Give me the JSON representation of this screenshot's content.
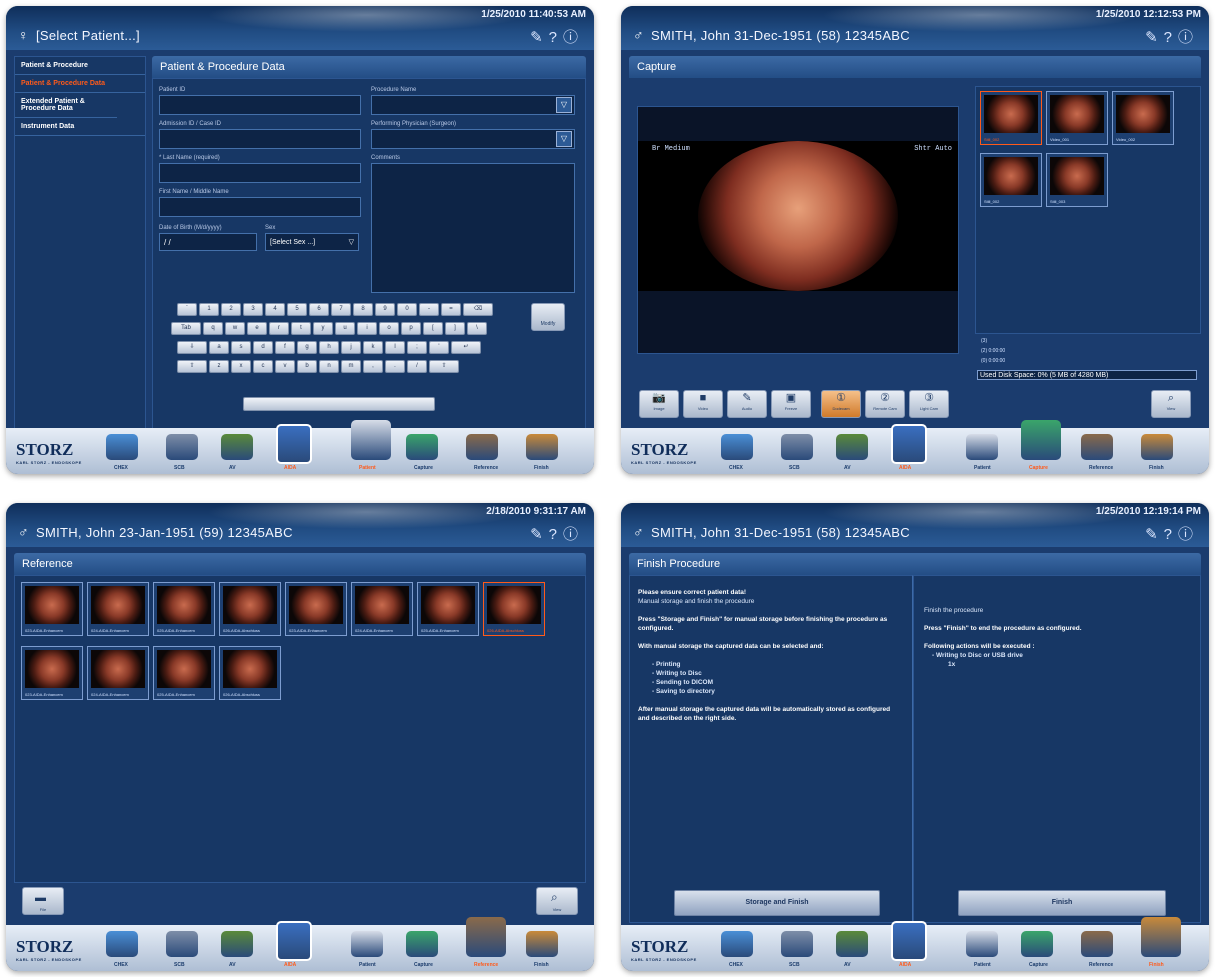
{
  "screens": {
    "patient": {
      "time": "1/25/2010 11:40:53 AM",
      "patient_header": "[Select Patient...]",
      "title": "Patient & Procedure Data",
      "side": {
        "heading": "Patient & Procedure",
        "items": [
          "Patient & Procedure Data",
          "Extended Patient & Procedure Data",
          "Instrument Data"
        ]
      },
      "fields": {
        "patient_id": "Patient ID",
        "admission_id": "Admission ID / Case ID",
        "last_name": "* Last Name (required)",
        "first_name": "First Name / Middle Name",
        "dob": "Date of Birth (M/d/yyyy)",
        "dob_value": "/ /",
        "sex": "Sex",
        "sex_value": "[Select Sex ...]",
        "procedure_name": "Procedure Name",
        "physician": "Performing Physician (Surgeon)",
        "comments": "Comments"
      },
      "keyboard": {
        "row1": [
          "`",
          "1",
          "2",
          "3",
          "4",
          "5",
          "6",
          "7",
          "8",
          "9",
          "0",
          "-",
          "=",
          "⌫"
        ],
        "row2": [
          "Tab",
          "q",
          "w",
          "e",
          "r",
          "t",
          "y",
          "u",
          "i",
          "o",
          "p",
          "[",
          "]",
          "\\"
        ],
        "row3": [
          "⇩",
          "a",
          "s",
          "d",
          "f",
          "g",
          "h",
          "j",
          "k",
          "l",
          ";",
          "'",
          "↵"
        ],
        "row4": [
          "⇧",
          "z",
          "x",
          "c",
          "v",
          "b",
          "n",
          "m",
          ",",
          ".",
          "/",
          "⇧"
        ],
        "modify": "Modify"
      },
      "dock": [
        "CHEX",
        "SCB",
        "AV",
        "AIDA",
        "Patient",
        "Capture",
        "Reference",
        "Finish"
      ]
    },
    "capture": {
      "time": "1/25/2010 12:12:53 PM",
      "patient_header": "SMITH, John   31-Dec-1951 (58)   12345ABC",
      "title": "Capture",
      "overlay_left": "Br Medium",
      "overlay_right": "Shtr Auto",
      "thumbs": [
        "Still_002",
        "Video_001",
        "Video_002",
        "Still_002",
        "Still_003"
      ],
      "counts": [
        "(3)",
        "(2)  0:00:00",
        "(0)  0:00:00"
      ],
      "disk": "Used Disk Space: 0% (5 MB of 4280 MB)",
      "toolbar": [
        "Image",
        "Video",
        "Audio",
        "Freeze",
        "Dodecam",
        "Remote Cam",
        "Light Cam",
        "View"
      ],
      "dock": [
        "CHEX",
        "SCB",
        "AV",
        "AIDA",
        "Patient",
        "Capture",
        "Reference",
        "Finish"
      ]
    },
    "reference": {
      "time": "2/18/2010 9:31:17 AM",
      "patient_header": "SMITH, John   23-Jan-1951 (59)   12345ABC",
      "title": "Reference",
      "thumb_captions": [
        "023-AIDA-Enhancem",
        "024-AIDA-Enhancem",
        "025-AIDA-Enhancem",
        "026-AIDA-Abschluss",
        "023-AIDA-Enhancem",
        "024-AIDA-Enhancem",
        "025-AIDA-Enhancem",
        "026-AIDA-Abschluss",
        "023-AIDA-Enhancem",
        "024-AIDA-Enhancem",
        "025-AIDA-Enhancem",
        "026-AIDA-Abschluss"
      ],
      "buttons": [
        "File",
        "View"
      ],
      "dock": [
        "CHEX",
        "SCB",
        "AV",
        "AIDA",
        "Patient",
        "Capture",
        "Reference",
        "Finish"
      ]
    },
    "finish": {
      "time": "1/25/2010 12:19:14 PM",
      "patient_header": "SMITH, John   31-Dec-1951 (58)   12345ABC",
      "title": "Finish Procedure",
      "left": {
        "warning": "Please ensure correct patient data!",
        "heading": "Manual storage and finish the procedure",
        "p1": "Press \"Storage and Finish\" for manual storage before finishing the procedure as configured.",
        "p2": "With manual storage the captured data can be selected and:",
        "list": [
          "- Printing",
          "- Writing to Disc",
          "- Sending to DICOM",
          "- Saving to directory"
        ],
        "p3": "After manual storage the captured data will be automatically stored as configured and described on the right side.",
        "button": "Storage and Finish"
      },
      "right": {
        "heading": "Finish the procedure",
        "p1": "Press \"Finish\" to end the procedure as configured.",
        "p2": "Following actions will be executed :",
        "action": "- Writing to Disc or USB drive",
        "count": "1x",
        "button": "Finish"
      },
      "dock": [
        "CHEX",
        "SCB",
        "AV",
        "AIDA",
        "Patient",
        "Capture",
        "Reference",
        "Finish"
      ]
    }
  },
  "brand": {
    "logo": "STORZ",
    "sub": "KARL STORZ - ENDOSKOPE"
  },
  "colors": {
    "selected": "#ff5a1a",
    "panel": "#1b3c6e"
  }
}
